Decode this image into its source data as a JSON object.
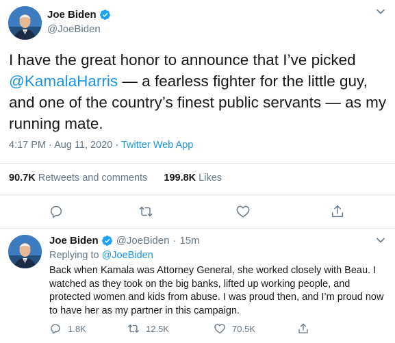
{
  "main_tweet": {
    "name": "Joe Biden",
    "handle": "@JoeBiden",
    "text_before": "I have the great honor to announce that I’ve picked ",
    "mention": "@KamalaHarris",
    "text_after": " — a fearless fighter for the little guy, and one of the country’s finest public servants — as my running mate.",
    "time": "4:17 PM",
    "date": "Aug 11, 2020",
    "separator": "·",
    "source": "Twitter Web App",
    "retweets_count": "90.7K",
    "retweets_label": "Retweets and comments",
    "likes_count": "199.8K",
    "likes_label": "Likes"
  },
  "reply_tweet": {
    "name": "Joe Biden",
    "handle": "@JoeBiden",
    "separator": "·",
    "age": "15m",
    "replying_label": "Replying to",
    "replying_to": "@JoeBiden",
    "text": "Back when Kamala was Attorney General, she worked closely with Beau. I watched as they took on the big banks, lifted up working people, and protected women and kids from abuse. I was proud then, and I’m proud now to have her as my partner in this campaign.",
    "replies": "1.8K",
    "retweets": "12.5K",
    "likes": "70.5K"
  },
  "colors": {
    "accent": "#1b95e0",
    "verified": "#1da1f2",
    "secondary_text": "#657786",
    "divider": "#e1e8ed"
  },
  "icons": [
    "avatar",
    "verified-badge-icon",
    "chevron-down-icon",
    "reply-icon",
    "retweet-icon",
    "like-icon",
    "share-icon"
  ]
}
